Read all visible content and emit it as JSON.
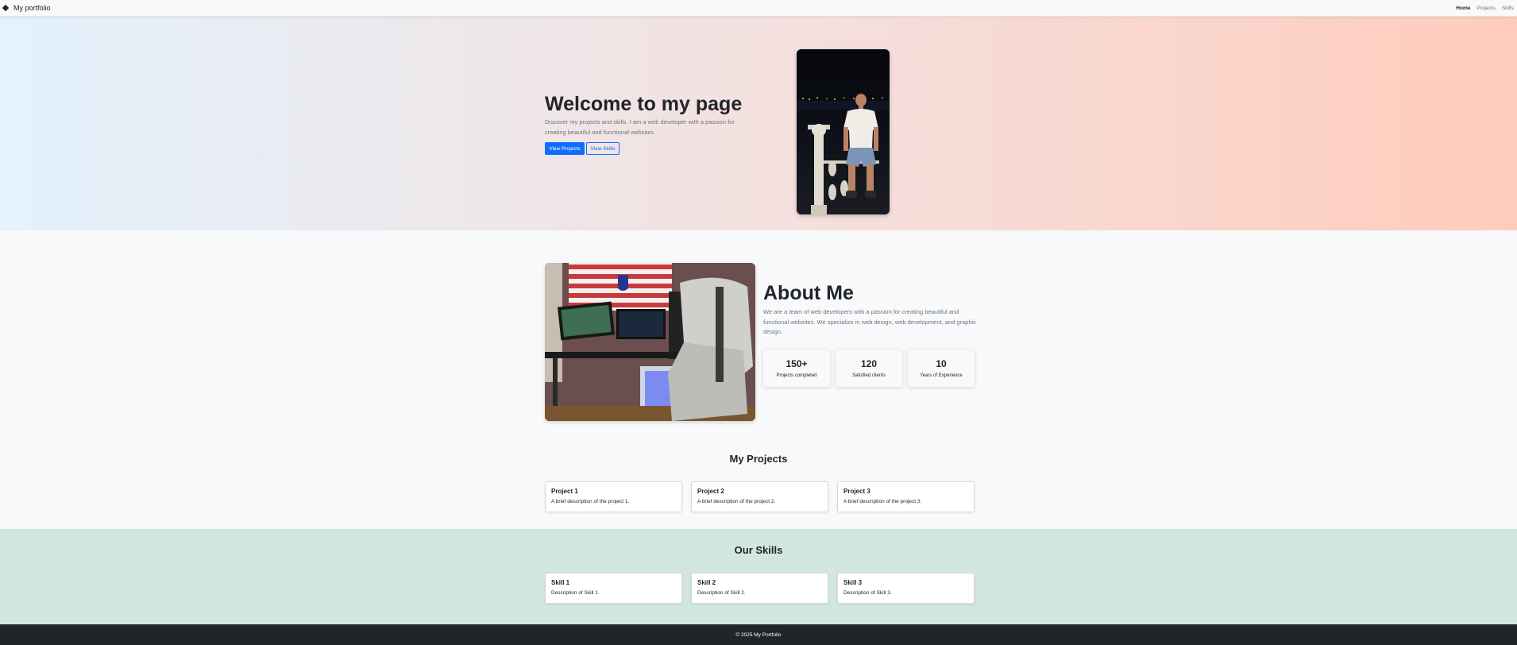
{
  "navbar": {
    "brand": "My portfolio",
    "links": [
      "Home",
      "Projects",
      "Skills"
    ]
  },
  "hero": {
    "title": "Welcome to my page",
    "subtitle": "Discover my projects and skills. I am a web developer with a passion for creating beautiful and functional websites.",
    "primary_button": "View Projects",
    "secondary_button": "View Skills"
  },
  "about": {
    "title": "About Me",
    "text": "We are a team of web developers with a passion for creating beautiful and functional websites. We specialize in web design, web development, and graphic design.",
    "stats": [
      {
        "value": "150+",
        "label": "Projects completed"
      },
      {
        "value": "120",
        "label": "Satisfied clients"
      },
      {
        "value": "10",
        "label": "Years of Experience"
      }
    ]
  },
  "projects": {
    "title": "My Projects",
    "items": [
      {
        "title": "Project 1",
        "desc": "A brief description of the project 1."
      },
      {
        "title": "Project 2",
        "desc": "A brief description of the project 2."
      },
      {
        "title": "Project 3",
        "desc": "A brief description of the project 3."
      }
    ]
  },
  "skills": {
    "title": "Our Skills",
    "items": [
      {
        "title": "Skill 1",
        "desc": "Description of Skill 1."
      },
      {
        "title": "Skill 2",
        "desc": "Description of Skill 2."
      },
      {
        "title": "Skill 3",
        "desc": "Description of Skill 3."
      }
    ]
  },
  "footer": {
    "text": "© 2025 My Portfolio"
  },
  "colors": {
    "primary": "#0d6efd",
    "dark": "#212529",
    "skills_bg": "#d1e7dd"
  }
}
